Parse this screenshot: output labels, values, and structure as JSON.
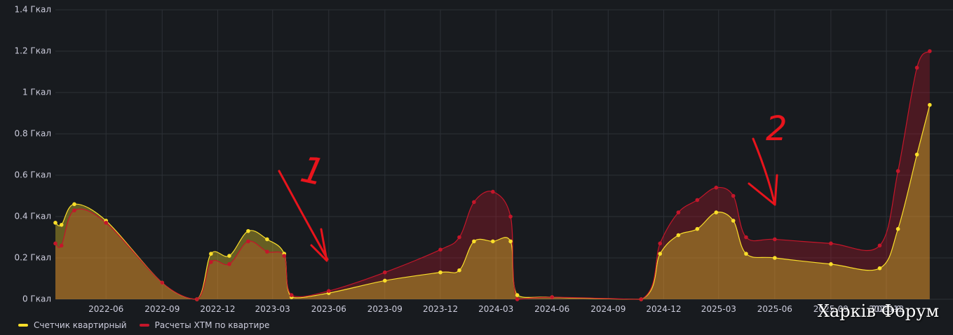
{
  "chart_data": {
    "type": "area",
    "ylim": [
      0,
      1.4
    ],
    "y_ticks": [
      "0 Гкал",
      "0.2 Гкал",
      "0.4 Гкал",
      "0.6 Гкал",
      "0.8 Гкал",
      "1 Гкал",
      "1.2 Гкал",
      "1.4 Гкал"
    ],
    "x_ticks": [
      "2022-06",
      "2022-09",
      "2022-12",
      "2023-03",
      "2023-06",
      "2023-09",
      "2023-12",
      "2024-03",
      "2024-06",
      "2024-09",
      "2024-12",
      "2025-03",
      "2025-06",
      "2025-09",
      "2025-12",
      "2026-0"
    ],
    "grid": true,
    "legend_position": "bottom-left",
    "series": [
      {
        "name": "Счетчик квартирный",
        "color": "#fade2a",
        "points": [
          [
            "2022-03-10",
            0.37
          ],
          [
            "2022-03-20",
            0.36
          ],
          [
            "2022-04-10",
            0.46
          ],
          [
            "2022-06-01",
            0.38
          ],
          [
            "2022-09-01",
            0.08
          ],
          [
            "2022-10-28",
            0.0
          ],
          [
            "2022-11-20",
            0.22
          ],
          [
            "2022-12-20",
            0.21
          ],
          [
            "2023-01-20",
            0.33
          ],
          [
            "2023-02-20",
            0.29
          ],
          [
            "2023-03-20",
            0.22
          ],
          [
            "2023-04-01",
            0.01
          ],
          [
            "2023-06-01",
            0.03
          ],
          [
            "2023-09-01",
            0.09
          ],
          [
            "2023-12-01",
            0.13
          ],
          [
            "2024-01-01",
            0.14
          ],
          [
            "2024-01-25",
            0.28
          ],
          [
            "2024-02-25",
            0.28
          ],
          [
            "2024-03-25",
            0.28
          ],
          [
            "2024-04-05",
            0.02
          ],
          [
            "2024-06-01",
            0.01
          ],
          [
            "2024-10-25",
            0.0
          ],
          [
            "2024-11-25",
            0.22
          ],
          [
            "2024-12-25",
            0.31
          ],
          [
            "2025-01-25",
            0.34
          ],
          [
            "2025-02-25",
            0.42
          ],
          [
            "2025-03-25",
            0.38
          ],
          [
            "2025-04-15",
            0.22
          ],
          [
            "2025-06-01",
            0.2
          ],
          [
            "2025-09-01",
            0.17
          ],
          [
            "2025-11-20",
            0.15
          ],
          [
            "2025-12-20",
            0.34
          ],
          [
            "2026-01-20",
            0.7
          ],
          [
            "2026-02-10",
            0.94
          ]
        ]
      },
      {
        "name": "Расчеты ХТМ по квартире",
        "color": "#c4162a",
        "points": [
          [
            "2022-03-10",
            0.27
          ],
          [
            "2022-03-20",
            0.26
          ],
          [
            "2022-04-10",
            0.43
          ],
          [
            "2022-06-01",
            0.37
          ],
          [
            "2022-09-01",
            0.08
          ],
          [
            "2022-10-28",
            0.0
          ],
          [
            "2022-11-20",
            0.18
          ],
          [
            "2022-12-20",
            0.17
          ],
          [
            "2023-01-20",
            0.28
          ],
          [
            "2023-02-20",
            0.23
          ],
          [
            "2023-03-20",
            0.21
          ],
          [
            "2023-04-01",
            0.02
          ],
          [
            "2023-06-01",
            0.04
          ],
          [
            "2023-09-01",
            0.13
          ],
          [
            "2023-12-01",
            0.24
          ],
          [
            "2024-01-01",
            0.3
          ],
          [
            "2024-01-25",
            0.47
          ],
          [
            "2024-02-25",
            0.52
          ],
          [
            "2024-03-25",
            0.4
          ],
          [
            "2024-04-05",
            0.0
          ],
          [
            "2024-06-01",
            0.01
          ],
          [
            "2024-10-25",
            0.0
          ],
          [
            "2024-11-25",
            0.27
          ],
          [
            "2024-12-25",
            0.42
          ],
          [
            "2025-01-25",
            0.48
          ],
          [
            "2025-02-25",
            0.54
          ],
          [
            "2025-03-25",
            0.5
          ],
          [
            "2025-04-15",
            0.3
          ],
          [
            "2025-06-01",
            0.29
          ],
          [
            "2025-09-01",
            0.27
          ],
          [
            "2025-11-20",
            0.26
          ],
          [
            "2025-12-20",
            0.62
          ],
          [
            "2026-01-20",
            1.12
          ],
          [
            "2026-02-10",
            1.2
          ]
        ]
      }
    ]
  },
  "legend": {
    "item1": "Счетчик квартирный",
    "item2": "Расчеты ХТМ по квартире"
  },
  "annotations": {
    "label1": "1",
    "label2": "2"
  },
  "watermark": "Харків Форум"
}
